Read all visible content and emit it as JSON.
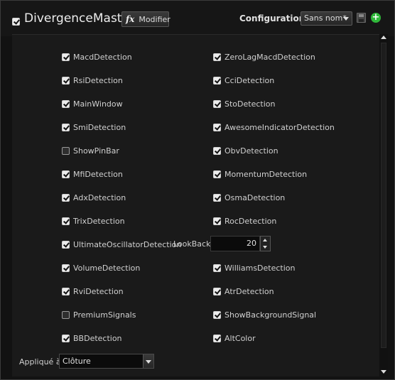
{
  "header": {
    "title": "DivergenceMaster",
    "title_checked": true,
    "modifier_label": "Modifier",
    "fx_symbol": "fx",
    "config_label": "Configuration :",
    "config_value": "Sans nom*",
    "save_icon": "save-icon",
    "add_icon": "add-icon",
    "add_symbol": "+"
  },
  "left_column": [
    {
      "label": "MacdDetection",
      "checked": true
    },
    {
      "label": "RsiDetection",
      "checked": true
    },
    {
      "label": "MainWindow",
      "checked": true
    },
    {
      "label": "SmiDetection",
      "checked": true
    },
    {
      "label": "ShowPinBar",
      "checked": false
    },
    {
      "label": "MfiDetection",
      "checked": true
    },
    {
      "label": "AdxDetection",
      "checked": true
    },
    {
      "label": "TrixDetection",
      "checked": true
    },
    {
      "label": "UltimateOscillatorDetection",
      "checked": true
    },
    {
      "label": "VolumeDetection",
      "checked": true
    },
    {
      "label": "RviDetection",
      "checked": true
    },
    {
      "label": "PremiumSignals",
      "checked": false
    },
    {
      "label": "BBDetection",
      "checked": true
    }
  ],
  "right_column": [
    {
      "label": "ZeroLagMacdDetection",
      "checked": true
    },
    {
      "label": "CciDetection",
      "checked": true
    },
    {
      "label": "StoDetection",
      "checked": true
    },
    {
      "label": "AwesomeIndicatorDetection",
      "checked": true
    },
    {
      "label": "ObvDetection",
      "checked": true
    },
    {
      "label": "MomentumDetection",
      "checked": true
    },
    {
      "label": "OsmaDetection",
      "checked": true
    },
    {
      "label": "RocDetection",
      "checked": true
    },
    null,
    {
      "label": "WilliamsDetection",
      "checked": true
    },
    {
      "label": "AtrDetection",
      "checked": true
    },
    {
      "label": "ShowBackgroundSignal",
      "checked": true
    },
    {
      "label": "AltColor",
      "checked": true
    }
  ],
  "lookback": {
    "label": "LookBack",
    "value": "20"
  },
  "applied": {
    "label": "Appliqué à",
    "value": "Clôture"
  },
  "colors": {
    "background": "#121212",
    "panel": "#1a1a1a",
    "add_green": "#2fb83a"
  }
}
